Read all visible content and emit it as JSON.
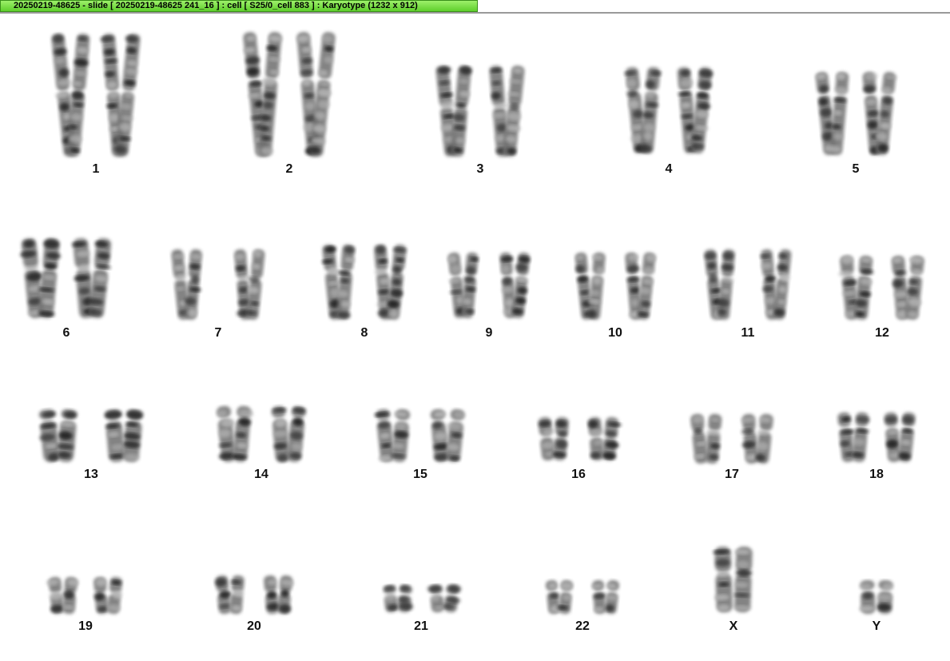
{
  "window": {
    "title": "20250219-48625 - slide [ 20250219-48625 241_16 ] : cell [ S25/0_cell 883 ] : Karyotype  (1232 x 912)"
  },
  "karyotype": {
    "chromosomes": [
      {
        "id": "1",
        "label": "1"
      },
      {
        "id": "2",
        "label": "2"
      },
      {
        "id": "3",
        "label": "3"
      },
      {
        "id": "4",
        "label": "4"
      },
      {
        "id": "5",
        "label": "5"
      },
      {
        "id": "6",
        "label": "6"
      },
      {
        "id": "7",
        "label": "7"
      },
      {
        "id": "8",
        "label": "8"
      },
      {
        "id": "9",
        "label": "9"
      },
      {
        "id": "10",
        "label": "10"
      },
      {
        "id": "11",
        "label": "11"
      },
      {
        "id": "12",
        "label": "12"
      },
      {
        "id": "13",
        "label": "13"
      },
      {
        "id": "14",
        "label": "14"
      },
      {
        "id": "15",
        "label": "15"
      },
      {
        "id": "16",
        "label": "16"
      },
      {
        "id": "17",
        "label": "17"
      },
      {
        "id": "18",
        "label": "18"
      },
      {
        "id": "19",
        "label": "19"
      },
      {
        "id": "20",
        "label": "20"
      },
      {
        "id": "21",
        "label": "21"
      },
      {
        "id": "22",
        "label": "22"
      },
      {
        "id": "X",
        "label": "X"
      },
      {
        "id": "Y",
        "label": "Y"
      }
    ],
    "colors": {
      "chromosome_dark": "#1e1e1e",
      "chromosome_mid": "#6e6e6e",
      "chromosome_light": "#b4b4b4",
      "title_bar": "#7ee04a"
    }
  }
}
